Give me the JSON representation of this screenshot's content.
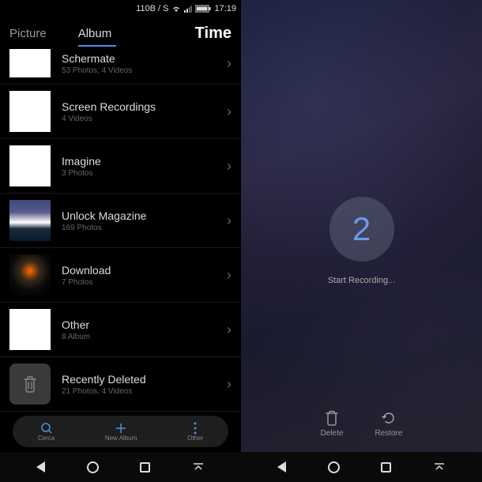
{
  "status": {
    "speed": "110B / S",
    "time": "17:19"
  },
  "tabs": {
    "picture": "Picture",
    "album": "Album",
    "time": "Time"
  },
  "albums": [
    {
      "title": "Schermate",
      "meta": "53 Photos, 4 Videos"
    },
    {
      "title": "Screen Recordings",
      "meta": "4 Videos"
    },
    {
      "title": "Imagine",
      "meta": "3 Photos"
    },
    {
      "title": "Unlock Magazine",
      "meta": "169 Photos"
    },
    {
      "title": "Download",
      "meta": "7 Photos"
    },
    {
      "title": "Other",
      "meta": "8 Album"
    },
    {
      "title": "Recently Deleted",
      "meta": "21 Photos, 4 Videos"
    }
  ],
  "toolbar": {
    "search": "Cerca",
    "new_album": "New Album",
    "other": "Other"
  },
  "right": {
    "countdown": "2",
    "label": "Start Recording...",
    "delete": "Delete",
    "restore": "Restore"
  }
}
